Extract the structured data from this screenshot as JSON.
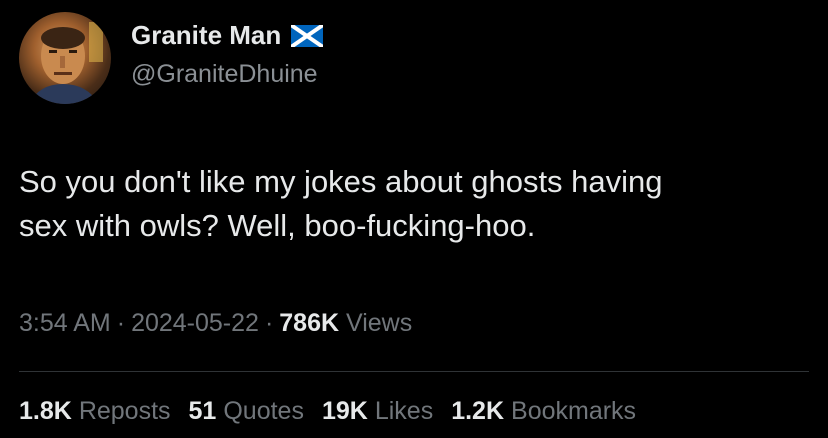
{
  "author": {
    "display_name": "Granite Man",
    "handle": "@GraniteDhuine",
    "flag_icon": "scotland-flag-icon"
  },
  "tweet": {
    "text_line1": "So you don't like my jokes about ghosts having",
    "text_line2": "sex with owls? Well, boo-fucking-hoo."
  },
  "meta": {
    "time": "3:54 AM",
    "date": "2024-05-22",
    "separator": "·",
    "views_count": "786K",
    "views_label": "Views"
  },
  "stats": {
    "reposts_count": "1.8K",
    "reposts_label": "Reposts",
    "quotes_count": "51",
    "quotes_label": "Quotes",
    "likes_count": "19K",
    "likes_label": "Likes",
    "bookmarks_count": "1.2K",
    "bookmarks_label": "Bookmarks"
  },
  "colors": {
    "background": "#000000",
    "primary_text": "#e7e9ea",
    "secondary_text": "#71767b",
    "flag_blue": "#0065bd"
  }
}
